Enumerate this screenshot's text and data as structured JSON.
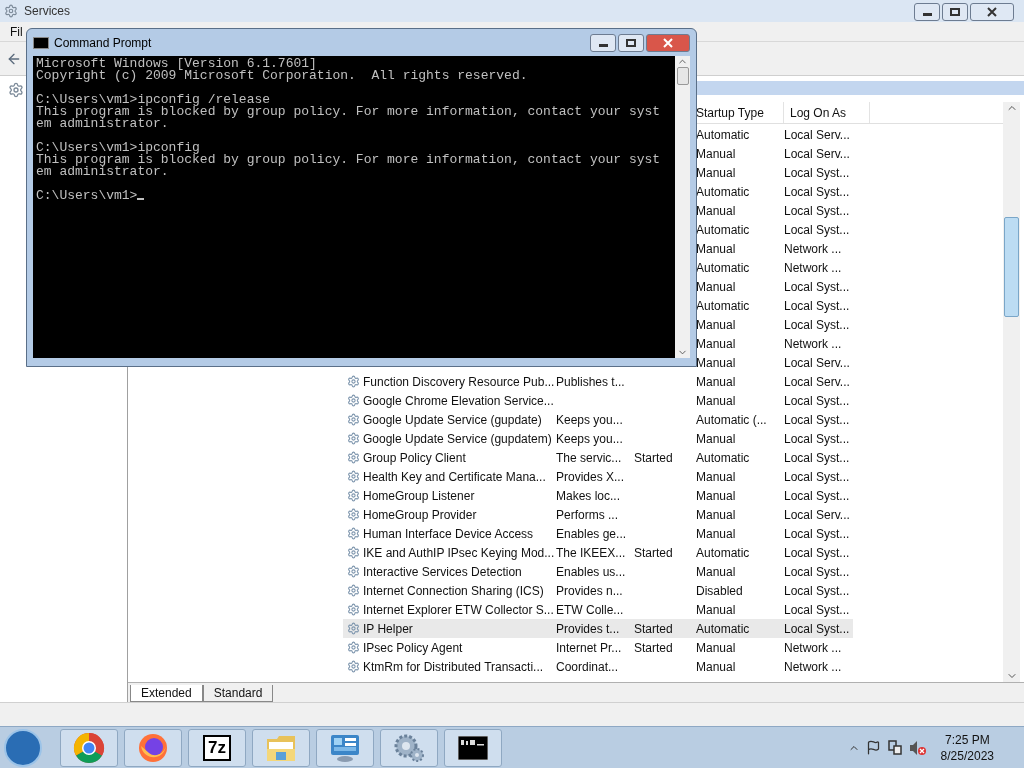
{
  "services_window": {
    "title": "Services",
    "menu": [
      "Fil"
    ],
    "columns": [
      "Startup Type",
      "Log On As"
    ],
    "rows": [
      {
        "startup": "Automatic",
        "logon": "Local Serv...",
        "selected": false
      },
      {
        "startup": "Manual",
        "logon": "Local Serv...",
        "selected": false
      },
      {
        "startup": "Manual",
        "logon": "Local Syst...",
        "selected": false
      },
      {
        "startup": "Automatic",
        "logon": "Local Syst...",
        "selected": false
      },
      {
        "startup": "Manual",
        "logon": "Local Syst...",
        "selected": false
      },
      {
        "startup": "Automatic",
        "logon": "Local Syst...",
        "selected": false
      },
      {
        "startup": "Manual",
        "logon": "Network ...",
        "selected": false
      },
      {
        "startup": "Automatic",
        "logon": "Network ...",
        "selected": false
      },
      {
        "startup": "Manual",
        "logon": "Local Syst...",
        "selected": false
      },
      {
        "startup": "Automatic",
        "logon": "Local Syst...",
        "selected": false
      },
      {
        "startup": "Manual",
        "logon": "Local Syst...",
        "selected": false
      },
      {
        "startup": "Manual",
        "logon": "Network ...",
        "selected": false
      },
      {
        "startup": "Manual",
        "logon": "Local Serv...",
        "selected": false
      },
      {
        "name": "Function Discovery Resource Pub...",
        "description": "Publishes t...",
        "startup": "Manual",
        "logon": "Local Serv...",
        "selected": false
      },
      {
        "name": "Google Chrome Elevation Service...",
        "startup": "Manual",
        "logon": "Local Syst...",
        "selected": false
      },
      {
        "name": "Google Update Service (gupdate)",
        "description": "Keeps you...",
        "startup": "Automatic (...",
        "logon": "Local Syst...",
        "selected": false
      },
      {
        "name": "Google Update Service (gupdatem)",
        "description": "Keeps you...",
        "startup": "Manual",
        "logon": "Local Syst...",
        "selected": false
      },
      {
        "name": "Group Policy Client",
        "description": "The servic...",
        "status": "Started",
        "startup": "Automatic",
        "logon": "Local Syst...",
        "selected": false
      },
      {
        "name": "Health Key and Certificate Mana...",
        "description": "Provides X...",
        "startup": "Manual",
        "logon": "Local Syst...",
        "selected": false
      },
      {
        "name": "HomeGroup Listener",
        "description": "Makes loc...",
        "startup": "Manual",
        "logon": "Local Syst...",
        "selected": false
      },
      {
        "name": "HomeGroup Provider",
        "description": "Performs ...",
        "startup": "Manual",
        "logon": "Local Serv...",
        "selected": false
      },
      {
        "name": "Human Interface Device Access",
        "description": "Enables ge...",
        "startup": "Manual",
        "logon": "Local Syst...",
        "selected": false
      },
      {
        "name": "IKE and AuthIP IPsec Keying Mod...",
        "description": "The IKEEX...",
        "status": "Started",
        "startup": "Automatic",
        "logon": "Local Syst...",
        "selected": false
      },
      {
        "name": "Interactive Services Detection",
        "description": "Enables us...",
        "startup": "Manual",
        "logon": "Local Syst...",
        "selected": false
      },
      {
        "name": "Internet Connection Sharing (ICS)",
        "description": "Provides n...",
        "startup": "Disabled",
        "logon": "Local Syst...",
        "selected": false
      },
      {
        "name": "Internet Explorer ETW Collector S...",
        "description": "ETW Colle...",
        "startup": "Manual",
        "logon": "Local Syst...",
        "selected": false
      },
      {
        "name": "IP Helper",
        "description": "Provides t...",
        "status": "Started",
        "startup": "Automatic",
        "logon": "Local Syst...",
        "selected": true
      },
      {
        "name": "IPsec Policy Agent",
        "description": "Internet Pr...",
        "status": "Started",
        "startup": "Manual",
        "logon": "Network ...",
        "selected": false
      },
      {
        "name": "KtmRm for Distributed Transacti...",
        "description": "Coordinat...",
        "startup": "Manual",
        "logon": "Network ...",
        "selected": false
      }
    ],
    "tabs": [
      {
        "label": "Extended",
        "selected": true
      },
      {
        "label": "Standard",
        "selected": false
      }
    ]
  },
  "cmd_window": {
    "title": "Command Prompt",
    "blocks": [
      [
        "Microsoft Windows [Version 6.1.7601]",
        "Copyright (c) 2009 Microsoft Corporation.  All rights reserved."
      ],
      [
        "C:\\Users\\vm1>ipconfig /release",
        "This program is blocked by group policy. For more information, contact your syst",
        "em administrator."
      ],
      [
        "C:\\Users\\vm1>ipconfig",
        "This program is blocked by group policy. For more information, contact your syst",
        "em administrator."
      ]
    ],
    "prompt": "C:\\Users\\vm1>"
  },
  "taskbar": {
    "apps": [
      {
        "kind": "chrome"
      },
      {
        "kind": "firefox"
      },
      {
        "kind": "sevenzip",
        "label": "7z"
      },
      {
        "kind": "explorer"
      },
      {
        "kind": "control-panel"
      },
      {
        "kind": "services"
      },
      {
        "kind": "cmd"
      }
    ],
    "time": "7:25 PM",
    "date": "8/25/2023"
  }
}
